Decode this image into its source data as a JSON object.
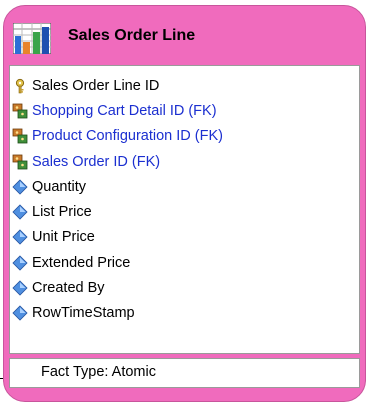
{
  "entity": {
    "title": "Sales Order Line",
    "header_icon": "fact-table-icon",
    "colors": {
      "header_fill": "#f06bbd",
      "fk_text": "#1b2fd0",
      "text": "#000000"
    },
    "attributes": [
      {
        "label": "Sales Order Line ID",
        "kind": "primary-key",
        "icon": "key-icon"
      },
      {
        "label": "Shopping Cart Detail ID (FK)",
        "kind": "foreign-key",
        "icon": "foreign-key-icon"
      },
      {
        "label": "Product Configuration ID (FK)",
        "kind": "foreign-key",
        "icon": "foreign-key-icon"
      },
      {
        "label": "Sales Order ID (FK)",
        "kind": "foreign-key",
        "icon": "foreign-key-icon"
      },
      {
        "label": "Quantity",
        "kind": "attribute",
        "icon": "diamond-icon"
      },
      {
        "label": "List Price",
        "kind": "attribute",
        "icon": "diamond-icon"
      },
      {
        "label": "Unit Price",
        "kind": "attribute",
        "icon": "diamond-icon"
      },
      {
        "label": "Extended Price",
        "kind": "attribute",
        "icon": "diamond-icon"
      },
      {
        "label": "Created By",
        "kind": "attribute",
        "icon": "diamond-icon"
      },
      {
        "label": "RowTimeStamp",
        "kind": "attribute",
        "icon": "diamond-icon"
      }
    ],
    "fact_type": "Fact Type: Atomic"
  }
}
